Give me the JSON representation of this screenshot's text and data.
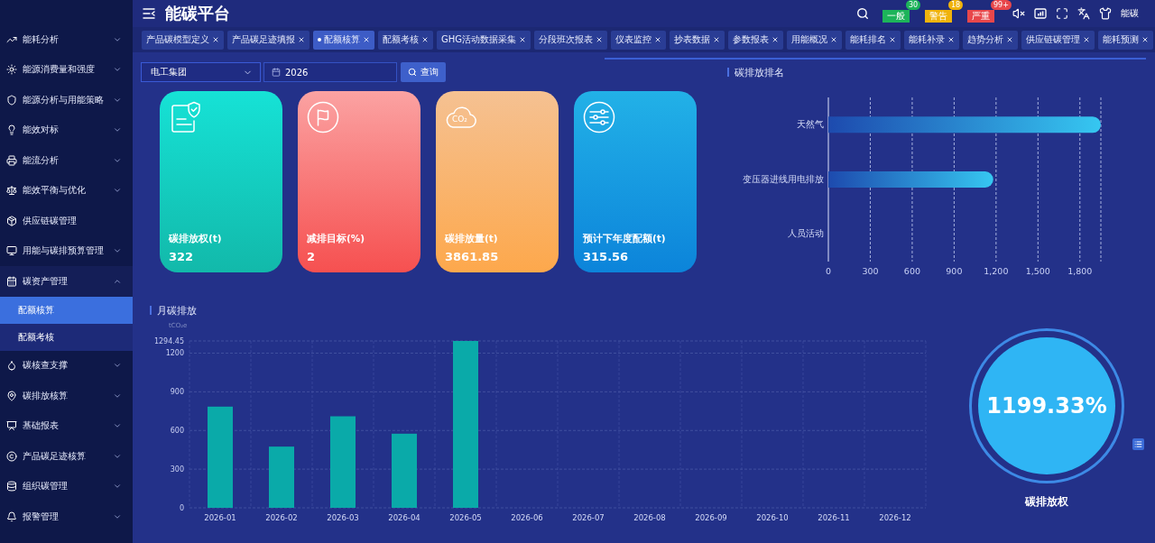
{
  "header": {
    "title": "能碳平台",
    "alerts": [
      {
        "label": "一般",
        "count": "30",
        "color": "#1db45a"
      },
      {
        "label": "警告",
        "count": "18",
        "color": "#f0b30c"
      },
      {
        "label": "严重",
        "count": "99+",
        "color": "#e8474b"
      }
    ],
    "user": "能碳"
  },
  "sidebar": {
    "items": [
      {
        "kind": "group",
        "label": "能耗分析",
        "expanded": false
      },
      {
        "kind": "group",
        "label": "能源消费量和强度",
        "expanded": false
      },
      {
        "kind": "group",
        "label": "能源分析与用能策略",
        "expanded": false
      },
      {
        "kind": "group",
        "label": "能效对标",
        "expanded": false
      },
      {
        "kind": "group",
        "label": "能流分析",
        "expanded": false
      },
      {
        "kind": "group",
        "label": "能效平衡与优化",
        "expanded": false
      },
      {
        "kind": "link",
        "label": "供应链碳管理"
      },
      {
        "kind": "group",
        "label": "用能与碳排预算管理",
        "expanded": false
      },
      {
        "kind": "group",
        "label": "碳资产管理",
        "expanded": true,
        "children": [
          {
            "label": "配额核算",
            "selected": true
          },
          {
            "label": "配额考核",
            "selected": false
          }
        ]
      },
      {
        "kind": "group",
        "label": "碳核查支撑",
        "expanded": false
      },
      {
        "kind": "group",
        "label": "碳排放核算",
        "expanded": false
      },
      {
        "kind": "group",
        "label": "基础报表",
        "expanded": false
      },
      {
        "kind": "group",
        "label": "产品碳足迹核算",
        "expanded": false
      },
      {
        "kind": "group",
        "label": "组织碳管理",
        "expanded": false
      },
      {
        "kind": "group",
        "label": "报警管理",
        "expanded": false
      }
    ]
  },
  "tabs": [
    {
      "label": "产品碳模型定义",
      "selected": false
    },
    {
      "label": "产品碳足迹填报",
      "selected": false
    },
    {
      "label": "配额核算",
      "selected": true
    },
    {
      "label": "配额考核",
      "selected": false
    },
    {
      "label": "GHG活动数据采集",
      "selected": false
    },
    {
      "label": "分段班次报表",
      "selected": false
    },
    {
      "label": "仪表监控",
      "selected": false
    },
    {
      "label": "抄表数据",
      "selected": false
    },
    {
      "label": "参数报表",
      "selected": false
    },
    {
      "label": "用能概况",
      "selected": false
    },
    {
      "label": "能耗排名",
      "selected": false
    },
    {
      "label": "能耗补录",
      "selected": false
    },
    {
      "label": "趋势分析",
      "selected": false
    },
    {
      "label": "供应链碳管理",
      "selected": false
    },
    {
      "label": "能耗预测",
      "selected": false
    }
  ],
  "filters": {
    "company": {
      "value": "电工集团"
    },
    "year": {
      "value": "2026"
    },
    "query_button": "查询"
  },
  "cards": [
    {
      "kind": "permit",
      "label": "碳排放权(t)",
      "value": "322"
    },
    {
      "kind": "target",
      "label": "减排目标(%)",
      "value": "2"
    },
    {
      "kind": "emission",
      "label": "碳排放量(t)",
      "value": "3861.85",
      "icon_text": "CO₂"
    },
    {
      "kind": "forecast",
      "label": "预计下年度配额(t)",
      "value": "315.56"
    }
  ],
  "ranking": {
    "title": "碳排放排名",
    "chart_data": {
      "type": "bar",
      "orientation": "horizontal",
      "grid": true,
      "categories": [
        "天然气",
        "变压器进线用电排放",
        "人员活动"
      ],
      "values": [
        1950,
        1180,
        0
      ],
      "xlim": [
        0,
        1950
      ],
      "xticks": [
        0,
        300,
        600,
        900,
        {
          "value": 1200,
          "label": "1,200"
        },
        {
          "value": 1500,
          "label": "1,500"
        },
        {
          "value": 1800,
          "label": "1,800"
        }
      ]
    }
  },
  "monthly": {
    "title": "月碳排放",
    "chart_data": {
      "type": "bar",
      "grid": true,
      "ylabel": "tCO₂e",
      "categories": [
        "2026-01",
        "2026-02",
        "2026-03",
        "2026-04",
        "2026-05",
        "2026-06",
        "2026-07",
        "2026-08",
        "2026-09",
        "2026-10",
        "2026-11",
        "2026-12"
      ],
      "values": [
        785,
        475,
        710,
        575,
        1294.45,
        null,
        null,
        null,
        null,
        null,
        null,
        null
      ],
      "ylim": [
        0,
        1294.45
      ],
      "yticks": [
        0,
        300,
        600,
        900,
        1200,
        1294.45
      ]
    }
  },
  "gauge": {
    "value": "1199.33%",
    "label": "碳排放权"
  }
}
